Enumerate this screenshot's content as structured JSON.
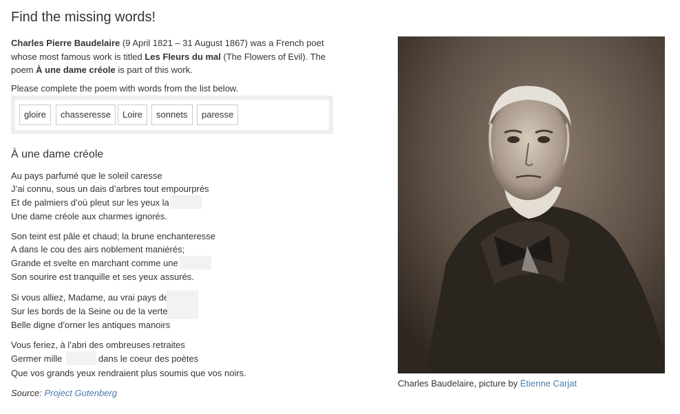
{
  "title": "Find the missing words!",
  "intro": {
    "poet": "Charles Pierre Baudelaire",
    "dates": " (9 April 1821 – 31 August 1867) was a French poet whose most famous work is titled ",
    "work": "Les Fleurs du mal",
    "work_translation": " (The Flowers of Evil). The poem ",
    "poem_name": "À une dame créole",
    "tail": " is part of this work."
  },
  "instruction": "Please complete the poem with words from the list below.",
  "word_bank": [
    "gloire",
    "chasseresse",
    "Loire",
    "sonnets",
    "paresse"
  ],
  "poem": {
    "title": "À une dame créole",
    "lines": [
      "Au pays parfumé que le soleil caresse",
      "J’ai connu, sous un dais d’arbres tout empourprés",
      "Et de palmiers d’où pleut sur les yeux la",
      "Une dame créole aux charmes ignorés.",
      "Son teint est pâle et chaud; la brune enchanteresse",
      "A dans le cou des airs noblement maniérés;",
      "Grande et svelte en marchant comme une",
      "Son sourire est tranquille et ses yeux assurés.",
      "Si vous alliez, Madame, au vrai pays de",
      "Sur les bords de la Seine ou de la verte",
      "Belle digne d’orner les antiques manoirs",
      "Vous feriez, à l’abri des ombreuses retraites",
      "Germer mille",
      "dans le coeur des poètes",
      "Que vos grands yeux rendraient plus soumis que vos noirs."
    ]
  },
  "source": {
    "label": "Source:",
    "link": "Project Gutenberg"
  },
  "photo": {
    "caption_prefix": "Charles Baudelaire, picture by ",
    "caption_link": "Étienne Carjat"
  }
}
